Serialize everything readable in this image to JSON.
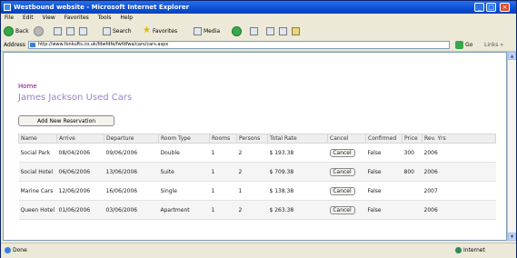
{
  "window": {
    "title": "Westbound website - Microsoft Internet Explorer",
    "min": "_",
    "max": "□",
    "close": "×"
  },
  "menu": [
    "File",
    "Edit",
    "View",
    "Favorites",
    "Tools",
    "Help"
  ],
  "toolbar": {
    "back": "Back",
    "search": "Search",
    "favorites": "Favorites",
    "media": "Media"
  },
  "address": {
    "label": "Address",
    "url": "http://www.fonkufts.co.uk/fdwfdfe/fwfdfwa/cars/cars.aspx",
    "go": "Go",
    "links": "Links »"
  },
  "page": {
    "home_link": "Home",
    "heading": "James Jackson Used Cars",
    "add_button": "Add New Reservation"
  },
  "table": {
    "columns": [
      "Name",
      "Arrive",
      "Departure",
      "Room Type",
      "Rooms",
      "Persons",
      "Total Rate",
      "Cancel",
      "Confirmed",
      "Price",
      "Rev. Yrs"
    ],
    "rows": [
      {
        "name": "Social Park",
        "arrive": "08/04/2006",
        "departure": "09/06/2006",
        "room_type": "Double",
        "rooms": "1",
        "persons": "2",
        "total": "$ 193.38",
        "cancel": "Cancel",
        "confirmed": "False",
        "price": "300",
        "year": "2006"
      },
      {
        "name": "Social Hotel",
        "arrive": "06/06/2006",
        "departure": "13/06/2006",
        "room_type": "Suite",
        "rooms": "1",
        "persons": "2",
        "total": "$ 709.38",
        "cancel": "Cancel",
        "confirmed": "False",
        "price": "800",
        "year": "2006"
      },
      {
        "name": "Marine Cars",
        "arrive": "12/06/2006",
        "departure": "16/06/2006",
        "room_type": "Single",
        "rooms": "1",
        "persons": "1",
        "total": "$ 138.38",
        "cancel": "Cancel",
        "confirmed": "False",
        "price": "",
        "year": "2007"
      },
      {
        "name": "Queen Hotel",
        "arrive": "01/06/2006",
        "departure": "03/06/2006",
        "room_type": "Apartment",
        "rooms": "1",
        "persons": "2",
        "total": "$ 263.38",
        "cancel": "Cancel",
        "confirmed": "False",
        "price": "",
        "year": "2006"
      }
    ]
  },
  "status": {
    "left": "Done",
    "right": "Internet"
  }
}
